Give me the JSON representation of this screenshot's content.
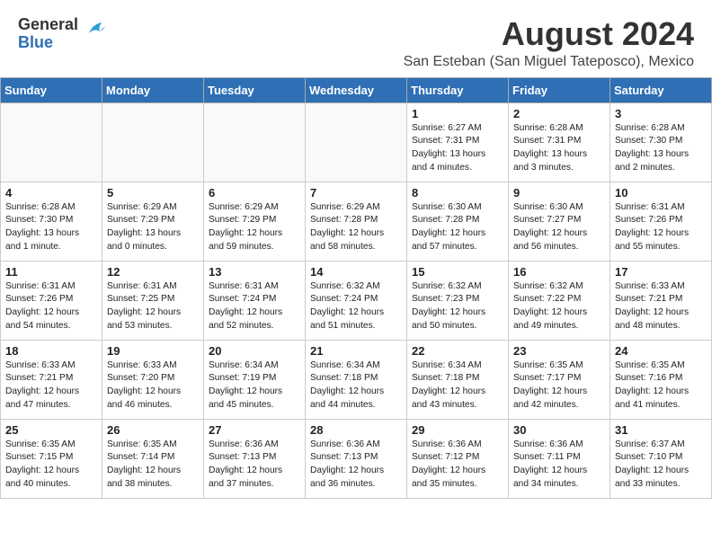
{
  "logo": {
    "general": "General",
    "blue": "Blue"
  },
  "title": {
    "month_year": "August 2024",
    "subtitle": "San Esteban (San Miguel Tateposco), Mexico"
  },
  "days_of_week": [
    "Sunday",
    "Monday",
    "Tuesday",
    "Wednesday",
    "Thursday",
    "Friday",
    "Saturday"
  ],
  "weeks": [
    [
      {
        "day": "",
        "info": ""
      },
      {
        "day": "",
        "info": ""
      },
      {
        "day": "",
        "info": ""
      },
      {
        "day": "",
        "info": ""
      },
      {
        "day": "1",
        "info": "Sunrise: 6:27 AM\nSunset: 7:31 PM\nDaylight: 13 hours\nand 4 minutes."
      },
      {
        "day": "2",
        "info": "Sunrise: 6:28 AM\nSunset: 7:31 PM\nDaylight: 13 hours\nand 3 minutes."
      },
      {
        "day": "3",
        "info": "Sunrise: 6:28 AM\nSunset: 7:30 PM\nDaylight: 13 hours\nand 2 minutes."
      }
    ],
    [
      {
        "day": "4",
        "info": "Sunrise: 6:28 AM\nSunset: 7:30 PM\nDaylight: 13 hours\nand 1 minute."
      },
      {
        "day": "5",
        "info": "Sunrise: 6:29 AM\nSunset: 7:29 PM\nDaylight: 13 hours\nand 0 minutes."
      },
      {
        "day": "6",
        "info": "Sunrise: 6:29 AM\nSunset: 7:29 PM\nDaylight: 12 hours\nand 59 minutes."
      },
      {
        "day": "7",
        "info": "Sunrise: 6:29 AM\nSunset: 7:28 PM\nDaylight: 12 hours\nand 58 minutes."
      },
      {
        "day": "8",
        "info": "Sunrise: 6:30 AM\nSunset: 7:28 PM\nDaylight: 12 hours\nand 57 minutes."
      },
      {
        "day": "9",
        "info": "Sunrise: 6:30 AM\nSunset: 7:27 PM\nDaylight: 12 hours\nand 56 minutes."
      },
      {
        "day": "10",
        "info": "Sunrise: 6:31 AM\nSunset: 7:26 PM\nDaylight: 12 hours\nand 55 minutes."
      }
    ],
    [
      {
        "day": "11",
        "info": "Sunrise: 6:31 AM\nSunset: 7:26 PM\nDaylight: 12 hours\nand 54 minutes."
      },
      {
        "day": "12",
        "info": "Sunrise: 6:31 AM\nSunset: 7:25 PM\nDaylight: 12 hours\nand 53 minutes."
      },
      {
        "day": "13",
        "info": "Sunrise: 6:31 AM\nSunset: 7:24 PM\nDaylight: 12 hours\nand 52 minutes."
      },
      {
        "day": "14",
        "info": "Sunrise: 6:32 AM\nSunset: 7:24 PM\nDaylight: 12 hours\nand 51 minutes."
      },
      {
        "day": "15",
        "info": "Sunrise: 6:32 AM\nSunset: 7:23 PM\nDaylight: 12 hours\nand 50 minutes."
      },
      {
        "day": "16",
        "info": "Sunrise: 6:32 AM\nSunset: 7:22 PM\nDaylight: 12 hours\nand 49 minutes."
      },
      {
        "day": "17",
        "info": "Sunrise: 6:33 AM\nSunset: 7:21 PM\nDaylight: 12 hours\nand 48 minutes."
      }
    ],
    [
      {
        "day": "18",
        "info": "Sunrise: 6:33 AM\nSunset: 7:21 PM\nDaylight: 12 hours\nand 47 minutes."
      },
      {
        "day": "19",
        "info": "Sunrise: 6:33 AM\nSunset: 7:20 PM\nDaylight: 12 hours\nand 46 minutes."
      },
      {
        "day": "20",
        "info": "Sunrise: 6:34 AM\nSunset: 7:19 PM\nDaylight: 12 hours\nand 45 minutes."
      },
      {
        "day": "21",
        "info": "Sunrise: 6:34 AM\nSunset: 7:18 PM\nDaylight: 12 hours\nand 44 minutes."
      },
      {
        "day": "22",
        "info": "Sunrise: 6:34 AM\nSunset: 7:18 PM\nDaylight: 12 hours\nand 43 minutes."
      },
      {
        "day": "23",
        "info": "Sunrise: 6:35 AM\nSunset: 7:17 PM\nDaylight: 12 hours\nand 42 minutes."
      },
      {
        "day": "24",
        "info": "Sunrise: 6:35 AM\nSunset: 7:16 PM\nDaylight: 12 hours\nand 41 minutes."
      }
    ],
    [
      {
        "day": "25",
        "info": "Sunrise: 6:35 AM\nSunset: 7:15 PM\nDaylight: 12 hours\nand 40 minutes."
      },
      {
        "day": "26",
        "info": "Sunrise: 6:35 AM\nSunset: 7:14 PM\nDaylight: 12 hours\nand 38 minutes."
      },
      {
        "day": "27",
        "info": "Sunrise: 6:36 AM\nSunset: 7:13 PM\nDaylight: 12 hours\nand 37 minutes."
      },
      {
        "day": "28",
        "info": "Sunrise: 6:36 AM\nSunset: 7:13 PM\nDaylight: 12 hours\nand 36 minutes."
      },
      {
        "day": "29",
        "info": "Sunrise: 6:36 AM\nSunset: 7:12 PM\nDaylight: 12 hours\nand 35 minutes."
      },
      {
        "day": "30",
        "info": "Sunrise: 6:36 AM\nSunset: 7:11 PM\nDaylight: 12 hours\nand 34 minutes."
      },
      {
        "day": "31",
        "info": "Sunrise: 6:37 AM\nSunset: 7:10 PM\nDaylight: 12 hours\nand 33 minutes."
      }
    ]
  ]
}
